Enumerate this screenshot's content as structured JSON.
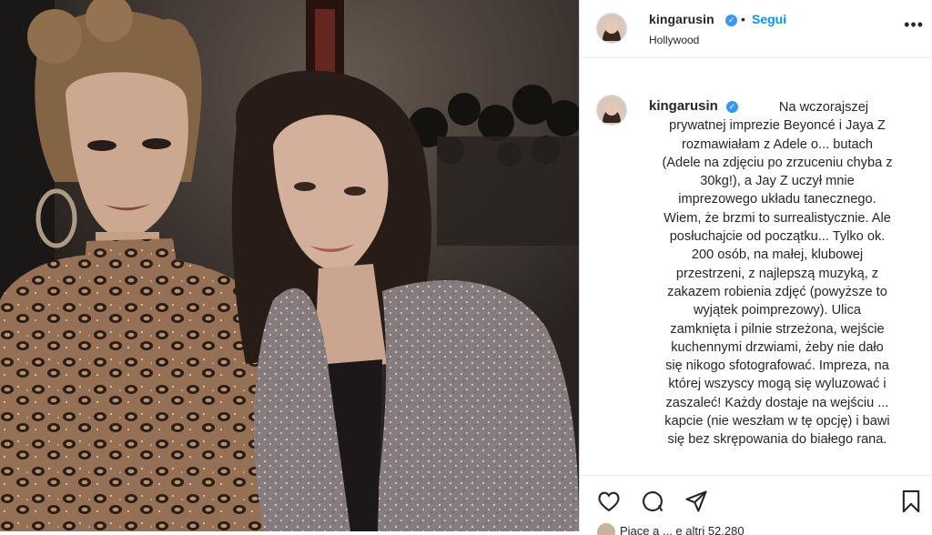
{
  "post": {
    "username": "kingarusin",
    "follow_label": "Segui",
    "separator": "•",
    "location": "Hollywood",
    "more_label": "•••",
    "verified_glyph": "✓",
    "caption_username": "kingarusin",
    "caption_text": "Na wczorajszej\nprywatnej imprezie Beyoncé i Jaya Z\nrozmawiałam z Adele o... butach\n(Adele na zdjęciu po zrzuceniu chyba z\n30kg!), a Jay Z uczył mnie\nimprezowego układu tanecznego.\nWiem, że brzmi to surrealistycznie. Ale\nposłuchajcie od początku... Tylko ok.\n200 osób, na małej,  klubowej\nprzestrzeni, z najlepszą muzyką, z\nzakazem robienia zdjęć (powyższe to\nwyjątek poimprezowy). Ulica\nzamknięta i pilnie strzeżona, wejście\nkuchennymi drzwiami, żeby nie dało\nsię nikogo sfotografować. Impreza, na\nktórej wszyscy mogą się wyluzować i\nzaszaleć! Każdy dostaje na wejściu ...\nkapcie (nie weszłam w tę opcję) i bawi\nsię bez skrępowania do białego rana.",
    "likes_text": "Piace a ... e altri 52.280"
  },
  "icons": {
    "like": "heart-icon",
    "comment": "comment-icon",
    "share": "share-icon",
    "save": "bookmark-icon"
  },
  "colors": {
    "follow": "#0095f6",
    "verified": "#3897f0",
    "text": "#262626",
    "border": "#dbdbdb"
  }
}
